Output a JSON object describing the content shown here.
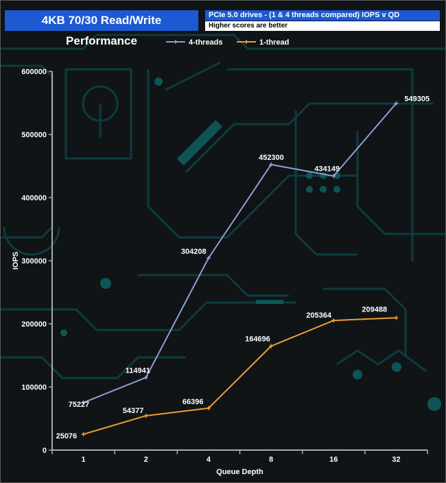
{
  "header": {
    "title": "4KB 70/30 Read/Write Performance",
    "subtitle": "PCIe 5.0 drives - (1 & 4 threads compared) IOPS v QD",
    "note": "Higher scores are better"
  },
  "chart_data": {
    "type": "line",
    "categories": [
      "1",
      "2",
      "4",
      "8",
      "16",
      "32"
    ],
    "series": [
      {
        "name": "4-threads",
        "values": [
          75227,
          114941,
          304208,
          452300,
          434149,
          549305
        ],
        "color": "#8da0d8"
      },
      {
        "name": "1-thread",
        "values": [
          25076,
          54377,
          66396,
          164696,
          205364,
          209488
        ],
        "color": "#f0a030"
      }
    ],
    "xlabel": "Queue Depth",
    "ylabel": "IOPS",
    "ylim": [
      0,
      600000
    ],
    "yticks": [
      0,
      100000,
      200000,
      300000,
      400000,
      500000,
      600000
    ],
    "legend": "top-center"
  },
  "colors": {
    "header_bg": "#1b5ad3",
    "axis": "#aaaaaa",
    "circuit": "#0f4a4d"
  }
}
